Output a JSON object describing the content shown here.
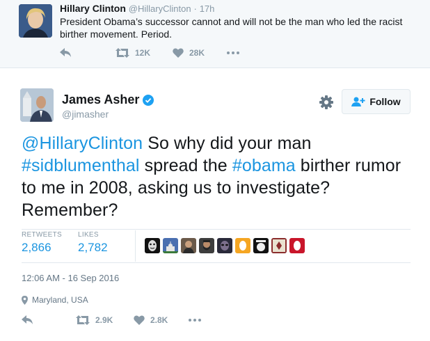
{
  "parent_tweet": {
    "name": "Hillary Clinton",
    "handle": "@HillaryClinton",
    "separator": "·",
    "time": "17h",
    "text": "President Obama’s successor cannot and will not be the man who led the racist birther movement. Period.",
    "actions": {
      "reply_icon": "reply-icon",
      "retweet_icon": "retweet-icon",
      "retweet_count": "12K",
      "like_icon": "heart-icon",
      "like_count": "28K",
      "more_icon": "more-icon"
    }
  },
  "tweet": {
    "author": {
      "name": "James Asher",
      "handle": "@jimasher",
      "verified": true
    },
    "settings_icon": "gear-icon",
    "follow_label": "Follow",
    "text": {
      "mention": "@HillaryClinton",
      "t1": " So why did your man ",
      "hashtag1": "#sidblumenthal",
      "t2": " spread the ",
      "hashtag2": "#obama",
      "t3": " birther rumor to me in 2008, asking us to investigate? Remember?"
    },
    "stats": {
      "retweets_label": "RETWEETS",
      "retweets_value": "2,866",
      "likes_label": "LIKES",
      "likes_value": "2,782"
    },
    "liker_avatars": [
      "mask",
      "capitol",
      "man",
      "bearded",
      "alien",
      "yellow-oval",
      "atari",
      "eagle",
      "red-oval"
    ],
    "timestamp": "12:06 AM - 16 Sep 2016",
    "location": "Maryland, USA",
    "actions": {
      "reply_icon": "reply-icon",
      "retweet_icon": "retweet-icon",
      "retweet_count": "2.9K",
      "like_icon": "heart-icon",
      "like_count": "2.8K",
      "more_icon": "more-icon"
    }
  },
  "colors": {
    "link": "#1b95e0",
    "muted": "#8899a6",
    "verified": "#1da1f2",
    "parent_bg": "#f5f8fa"
  }
}
